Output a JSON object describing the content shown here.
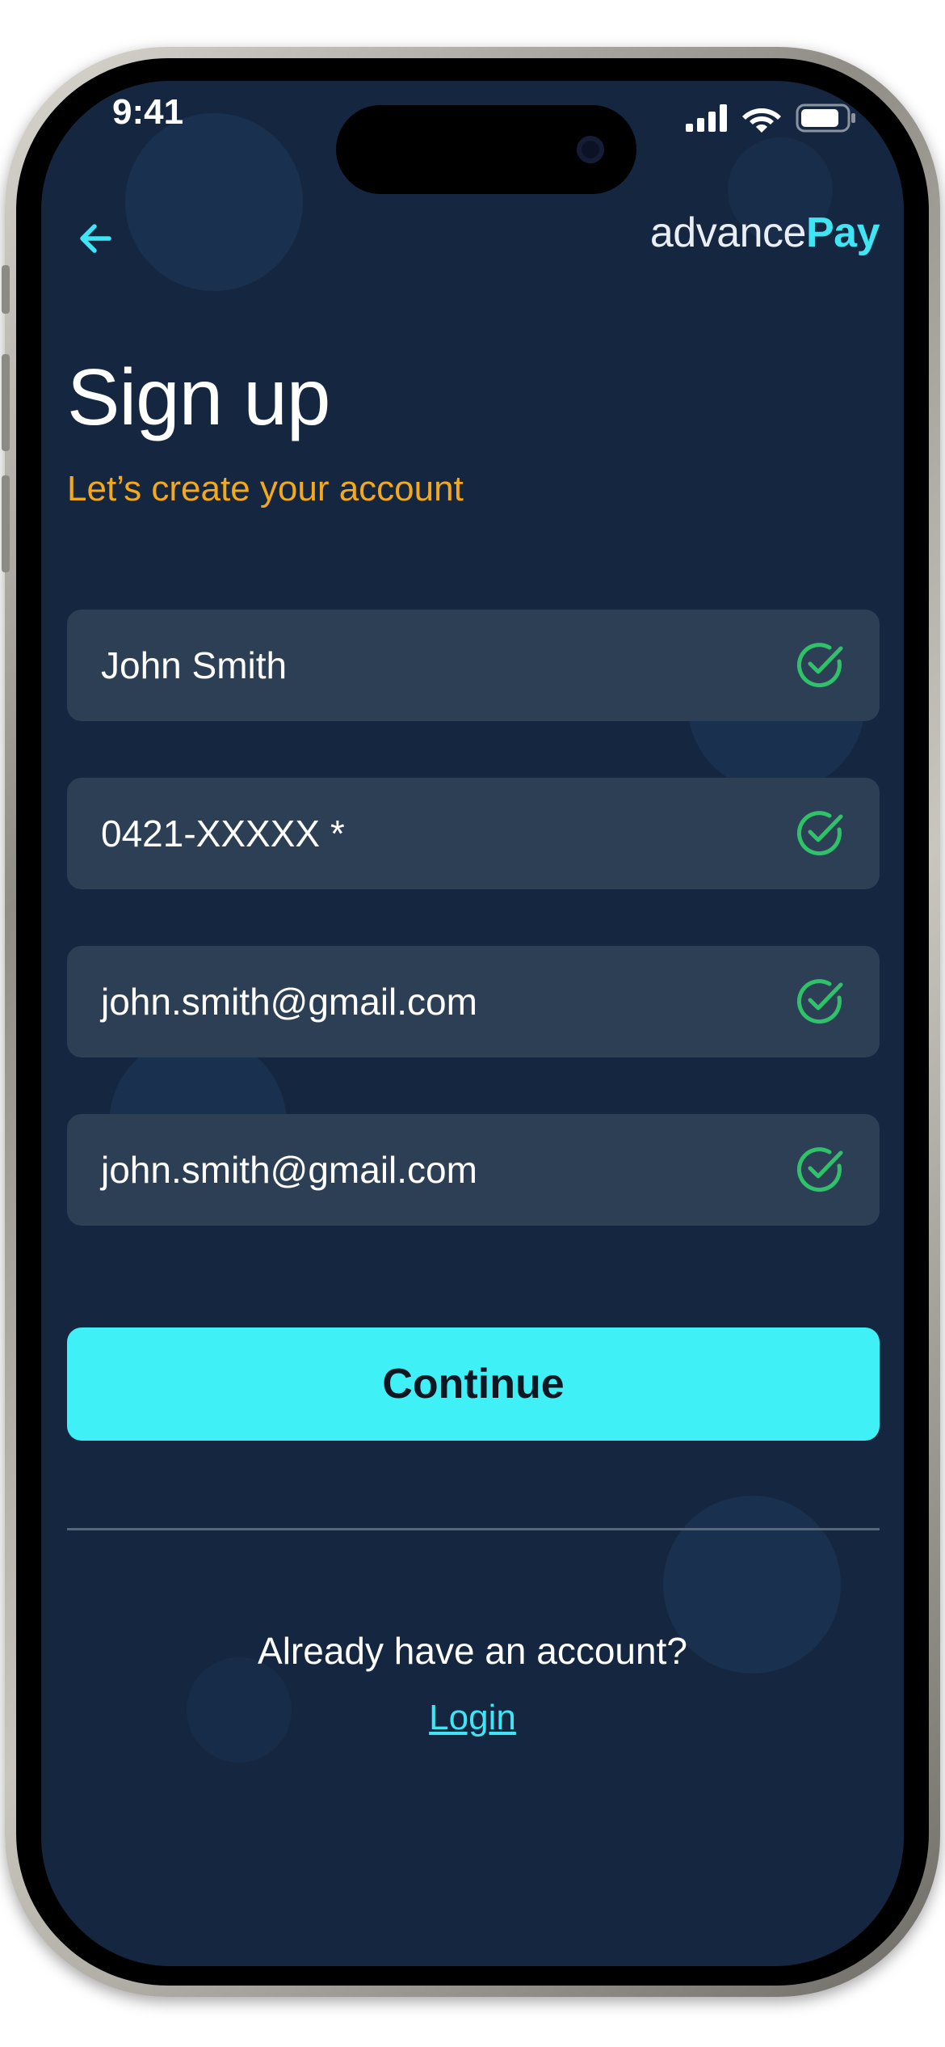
{
  "status_bar": {
    "time": "9:41",
    "icons": [
      "cellular-signal-icon",
      "wifi-icon",
      "battery-icon"
    ]
  },
  "header": {
    "back_icon": "arrow-left-icon",
    "logo_light": "advance",
    "logo_bold": "Pay"
  },
  "page": {
    "title": "Sign up",
    "subtitle": "Let’s create your account"
  },
  "form": {
    "fields": [
      {
        "value": "John Smith",
        "status_icon": "check-circle-icon"
      },
      {
        "value": "0421-XXXXX *",
        "status_icon": "check-circle-icon"
      },
      {
        "value": "john.smith@gmail.com",
        "status_icon": "check-circle-icon"
      },
      {
        "value": "john.smith@gmail.com",
        "status_icon": "check-circle-icon"
      }
    ],
    "continue_label": "Continue"
  },
  "footer": {
    "prompt": "Already have an account?",
    "login_label": "Login"
  },
  "colors": {
    "background": "#152740",
    "field": "#2d3f55",
    "accent_cyan": "#40f0f7",
    "subtitle_orange": "#f4a91b",
    "check_green": "#2fc26a"
  }
}
